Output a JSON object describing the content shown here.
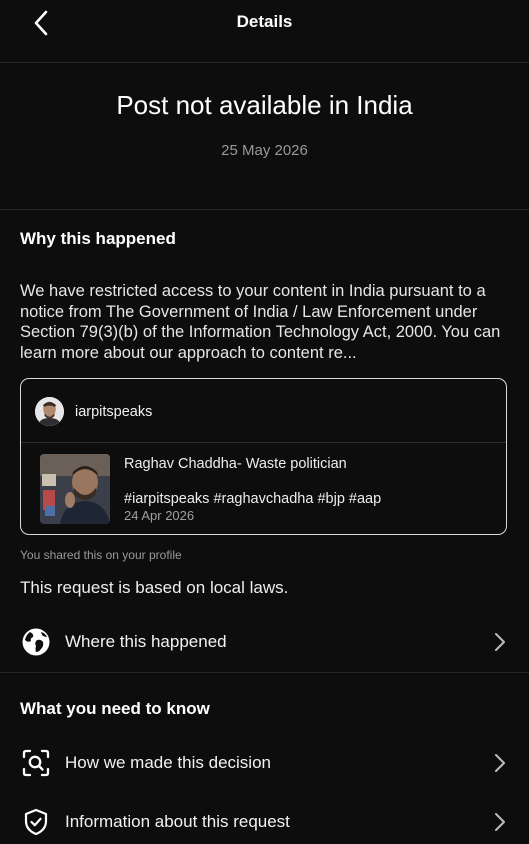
{
  "header": {
    "title": "Details",
    "back_icon": "chevron-left-icon"
  },
  "hero": {
    "title": "Post not available in India",
    "date": "25 May 2026"
  },
  "why": {
    "heading": "Why this happened",
    "body": "We have restricted access to your content in India pursuant to a notice from The Government of India / Law Enforcement under Section 79(3)(b) of the Information Technology Act, 2000. You can learn more about our approach to content re..."
  },
  "post_card": {
    "username": "iarpitspeaks",
    "caption": "Raghav Chaddha- Waste politician",
    "hashtags": "#iarpitspeaks #raghavchadha #bjp #aap",
    "date": "24 Apr 2026"
  },
  "shared_note": "You shared this on your profile",
  "local_laws": "This request is based on local laws.",
  "where_row": {
    "label": "Where this happened",
    "icon": "globe-icon"
  },
  "need_to_know": {
    "heading": "What you need to know",
    "items": [
      {
        "label": "How we made this decision",
        "icon": "scan-search-icon"
      },
      {
        "label": "Information about this request",
        "icon": "shield-check-icon"
      }
    ]
  },
  "colors": {
    "background": "#0d0d0d",
    "text": "#f2f2f2",
    "muted": "#9a9a9a",
    "divider": "#262626"
  }
}
